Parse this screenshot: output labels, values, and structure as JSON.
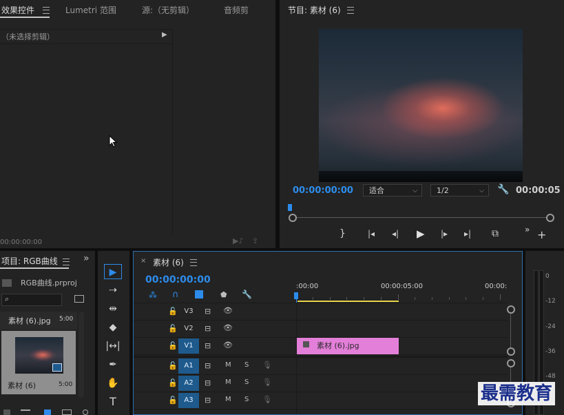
{
  "effects_panel": {
    "tabs": [
      "效果控件",
      "Lumetri 范围",
      "源:（无剪辑）",
      "音频剪"
    ],
    "no_clip": "（未选择剪辑）",
    "timecode": "00:00:00:00"
  },
  "program_monitor": {
    "title": "节目: 素材 (6)",
    "timecode_current": "00:00:00:00",
    "fit_option": "适合",
    "resolution": "1/2",
    "timecode_duration": "00:00:05"
  },
  "project_panel": {
    "title": "项目: RGB曲线",
    "file_name": "RGB曲线.prproj",
    "items": [
      {
        "name": "素材 (6).jpg",
        "duration": "5:00"
      },
      {
        "name": "素材 (6)",
        "duration": "5:00"
      }
    ]
  },
  "timeline": {
    "sequence_name": "素材 (6)",
    "timecode": "00:00:00:00",
    "ruler": [
      ":00:00",
      "00:00:05:00",
      "00:00:"
    ],
    "video_tracks": [
      "V3",
      "V2",
      "V1"
    ],
    "audio_tracks": [
      "A1",
      "A2",
      "A3"
    ],
    "mute_label": "M",
    "solo_label": "S",
    "clip_name": "素材 (6).jpg"
  },
  "audio_meter": {
    "labels": [
      "0",
      "-12",
      "-24",
      "-36",
      "-48"
    ]
  },
  "watermark": "最需教育",
  "colors": {
    "accent": "#2d8ceb",
    "clip": "#e37fd9",
    "panel": "#232323",
    "track_active": "#1e5a8c"
  }
}
